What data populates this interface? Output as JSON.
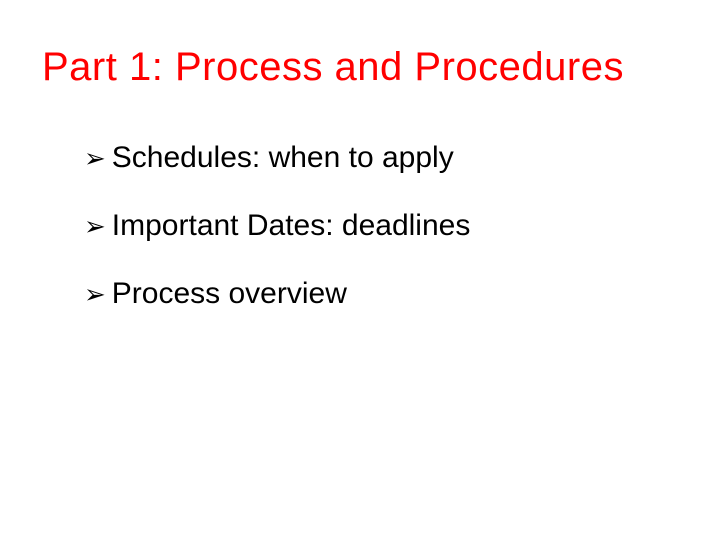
{
  "title": "Part 1: Process and Procedures",
  "bullets": [
    {
      "text": "Schedules: when to apply"
    },
    {
      "text": "Important Dates: deadlines"
    },
    {
      "text": "Process overview"
    }
  ]
}
